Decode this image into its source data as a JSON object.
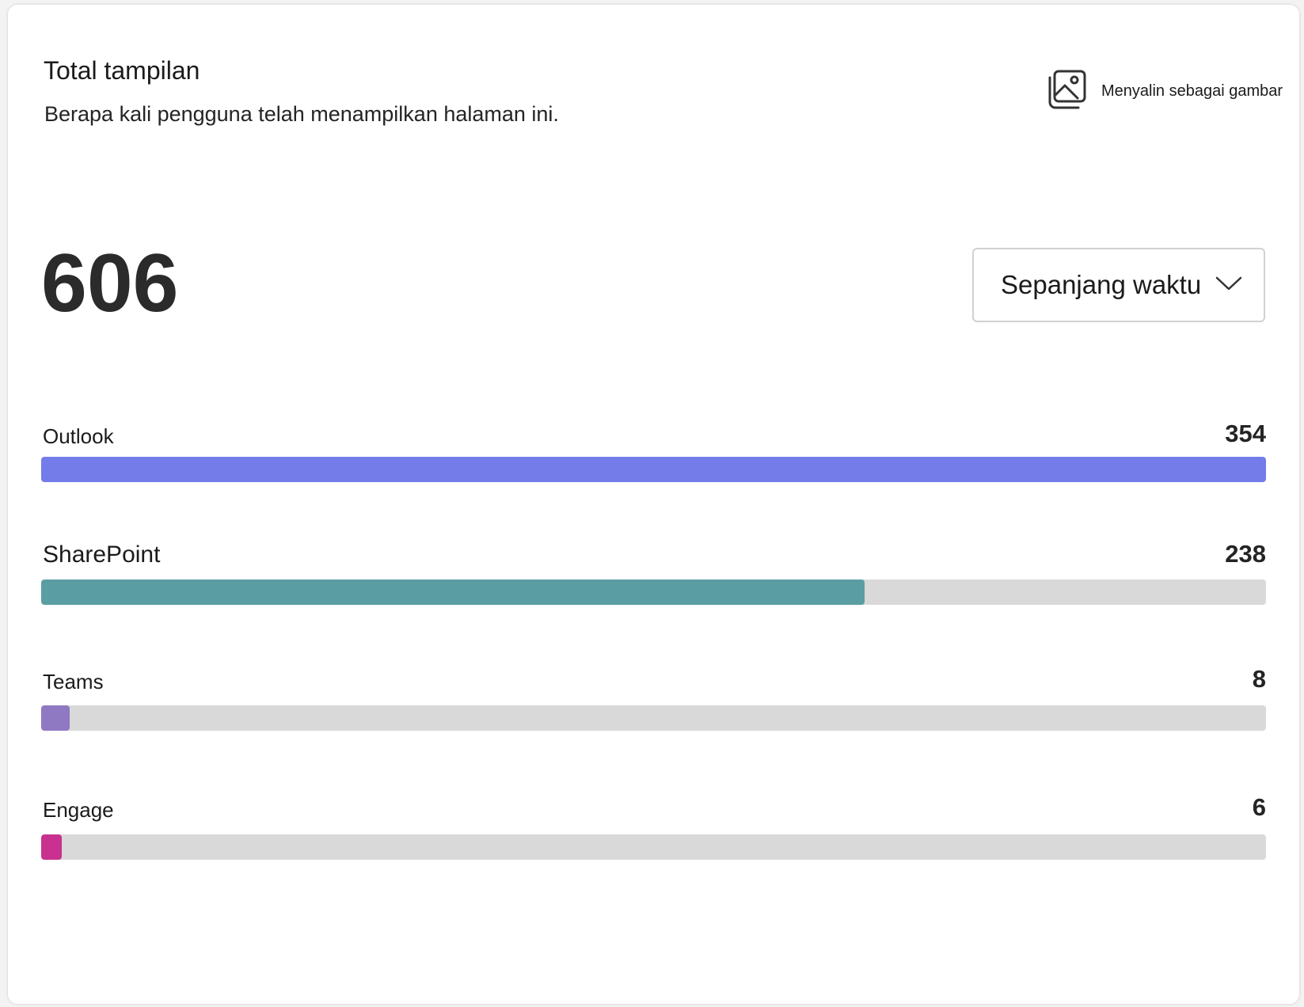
{
  "card": {
    "title": "Total tampilan",
    "subtitle": "Berapa kali pengguna telah menampilkan halaman ini.",
    "copy_button_label": "Menyalin sebagai gambar",
    "copy_button_icon": "image-copy-icon",
    "total_views": "606",
    "time_range": {
      "selected": "Sepanjang waktu",
      "icon": "chevron-down-icon"
    }
  },
  "sources": [
    {
      "label": "Outlook",
      "value": "354",
      "fraction": 1.0,
      "color": "#737ce8"
    },
    {
      "label": "SharePoint",
      "value": "238",
      "fraction": 0.672,
      "color": "#5a9ea3"
    },
    {
      "label": "Teams",
      "value": "8",
      "fraction": 0.023,
      "color": "#8e79c2"
    },
    {
      "label": "Engage",
      "value": "6",
      "fraction": 0.017,
      "color": "#c8318f"
    }
  ]
}
